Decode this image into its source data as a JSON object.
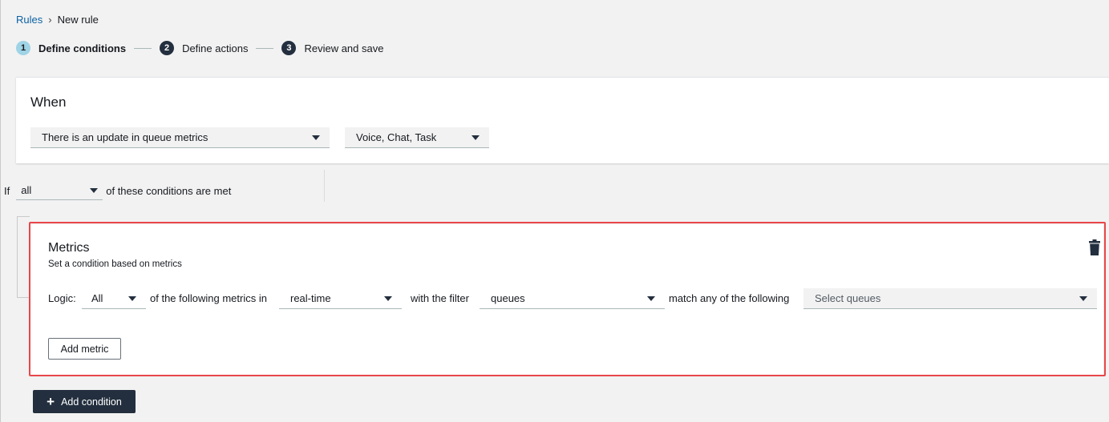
{
  "breadcrumb": {
    "parent": "Rules",
    "separator": "›",
    "current": "New rule"
  },
  "steps": [
    {
      "number": "1",
      "label": "Define conditions",
      "active": true
    },
    {
      "number": "2",
      "label": "Define actions",
      "active": false
    },
    {
      "number": "3",
      "label": "Review and save",
      "active": false
    }
  ],
  "when": {
    "title": "When",
    "event_select": "There is an update in queue metrics",
    "channels_select": "Voice, Chat, Task"
  },
  "if_row": {
    "prefix": "If",
    "match_select": "all",
    "suffix": "of these conditions are met"
  },
  "metrics": {
    "title": "Metrics",
    "subtitle": "Set a condition based on metrics",
    "logic_label": "Logic:",
    "logic_select": "All",
    "text_following": "of the following metrics in",
    "time_select": "real-time",
    "text_filter": "with the filter",
    "filter_select": "queues",
    "text_match": "match any of the following",
    "queues_placeholder": "Select queues",
    "add_metric_label": "Add metric"
  },
  "add_condition_label": "Add condition",
  "colors": {
    "link": "#0b62a4",
    "dark_button": "#232f3e",
    "active_step": "#9fd3e6",
    "highlight_border": "#e8474a"
  }
}
